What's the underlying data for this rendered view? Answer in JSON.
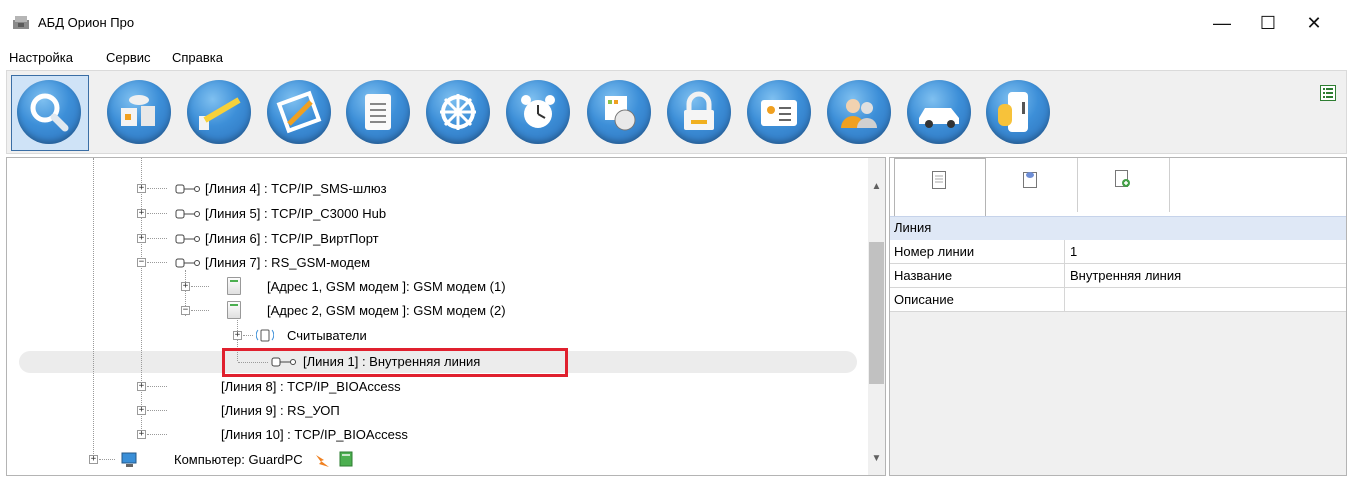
{
  "window": {
    "title": "АБД Орион Про",
    "controls": {
      "minimize": "—",
      "maximize": "☐",
      "close": "✕"
    }
  },
  "menu": [
    "Настройка",
    "Сервис",
    "Справка"
  ],
  "toolbar": {
    "buttons": [
      "search-icon",
      "devices-icon",
      "barrier-icon",
      "floorplan-icon",
      "document-icon",
      "wheel-icon",
      "alarm-clock-icon",
      "schedule-icon",
      "lock-icon",
      "id-card-icon",
      "users-icon",
      "car-icon",
      "key-icon"
    ],
    "active_index": 0
  },
  "tree": {
    "rows": [
      {
        "label": "[Линия 4] : TCP/IP_SMS-шлюз"
      },
      {
        "label": "[Линия 5] : TCP/IP_C3000 Hub"
      },
      {
        "label": "[Линия 6] : TCP/IP_ВиртПорт"
      },
      {
        "label": "[Линия 7] : RS_GSM-модем"
      },
      {
        "label": "[Адрес 1, GSM модем ]: GSM модем (1)"
      },
      {
        "label": "[Адрес 2, GSM модем ]: GSM модем (2)"
      },
      {
        "label": "Считыватели"
      },
      {
        "label": "[Линия 1] : Внутренняя линия"
      },
      {
        "label": "[Линия 8] : TCP/IP_BIOAccess"
      },
      {
        "label": "[Линия 9] : RS_УОП"
      },
      {
        "label": "[Линия 10] : TCP/IP_BIOAccess"
      },
      {
        "label": "Компьютер: GuardPC"
      }
    ],
    "selected_index": 7
  },
  "properties": {
    "tabs": [
      "document-icon",
      "comment-icon",
      "add-document-icon"
    ],
    "section": "Линия",
    "rows": [
      {
        "name": "Номер линии",
        "value": "1"
      },
      {
        "name": "Название",
        "value": "Внутренняя линия"
      },
      {
        "name": "Описание",
        "value": ""
      }
    ]
  }
}
